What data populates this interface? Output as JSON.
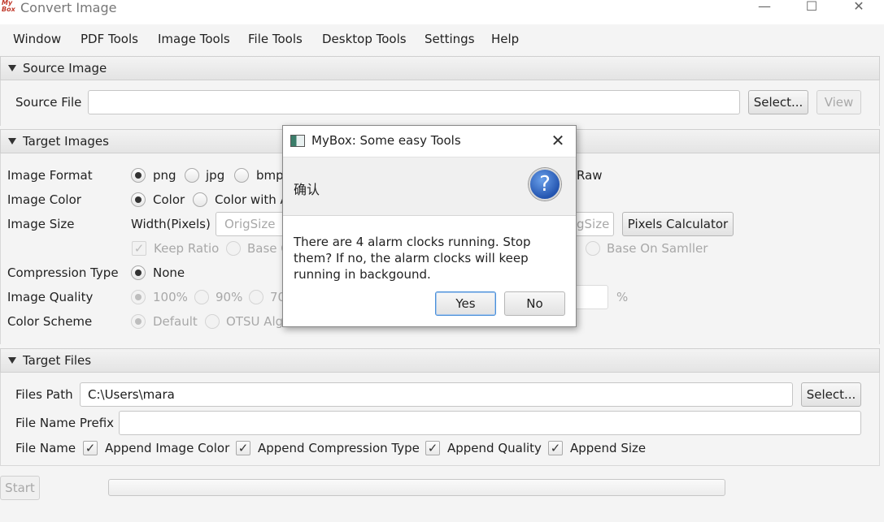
{
  "window": {
    "logo_text": "My Box",
    "title": "Convert Image",
    "controls": {
      "minimize": "—",
      "maximize": "☐",
      "close": "✕"
    }
  },
  "menu": [
    "Window",
    "PDF Tools",
    "Image Tools",
    "File Tools",
    "Desktop Tools",
    "Settings",
    "Help"
  ],
  "source": {
    "header": "Source Image",
    "file_label": "Source File",
    "file_value": "",
    "select_label": "Select...",
    "view_label": "View"
  },
  "target_images": {
    "header": "Target Images",
    "format_label": "Image Format",
    "formats": [
      "png",
      "jpg",
      "bmp"
    ],
    "format_raw": "Raw",
    "color_label": "Image Color",
    "colors": [
      "Color",
      "Color with A"
    ],
    "size_label": "Image Size",
    "width_label": "Width(Pixels)",
    "width_placeholder": "OrigSize",
    "height_placeholder_fragment": "gSize",
    "pixels_calc_label": "Pixels Calculator",
    "keep_ratio_label": "Keep Ratio",
    "base_label_fragment": "Base O",
    "base_smaller_label": "Base On Samller",
    "compression_label": "Compression Type",
    "compression_value": "None",
    "quality_label": "Image Quality",
    "qualities": [
      "100%",
      "90%",
      "70"
    ],
    "quality_unit": "%",
    "scheme_label": "Color Scheme",
    "schemes": [
      "Default",
      "OTSU Alg"
    ]
  },
  "target_files": {
    "header": "Target Files",
    "path_label": "Files Path",
    "path_value": "C:\\Users\\mara",
    "select_label": "Select...",
    "prefix_label": "File Name Prefix",
    "prefix_value": "",
    "name_label": "File Name",
    "append_options": [
      "Append Image Color",
      "Append Compression Type",
      "Append Quality",
      "Append Size"
    ]
  },
  "start_label": "Start",
  "dialog": {
    "title": "MyBox: Some easy Tools",
    "close": "✕",
    "header_text": "确认",
    "question_mark": "?",
    "message": "There are 4 alarm clocks running. Stop them? If no, the alarm clocks will keep running in backgound.",
    "yes_label": "Yes",
    "no_label": "No"
  }
}
